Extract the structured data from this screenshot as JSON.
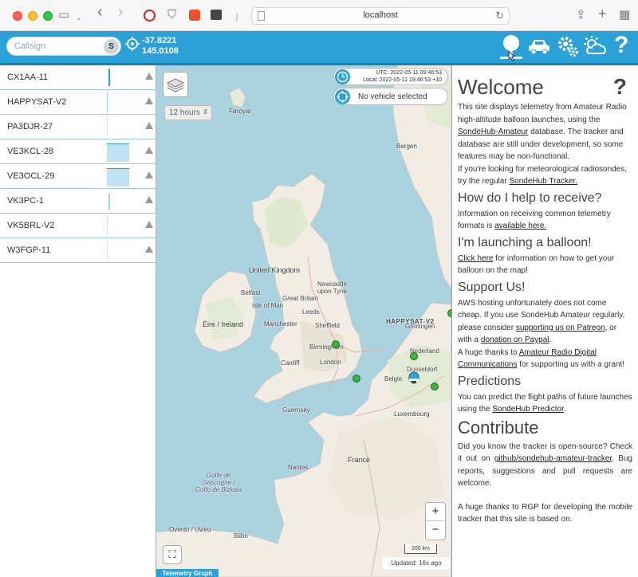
{
  "browser": {
    "url": "localhost"
  },
  "search": {
    "placeholder": "Callsign",
    "button": "S"
  },
  "coords": {
    "lat": "-37.8221",
    "lon": "145.0108"
  },
  "toolbar_icons": [
    "location-pin-icon",
    "car-icon",
    "settings-gears-icon",
    "weather-icon",
    "help-icon"
  ],
  "accent_color": "#2aa2d8",
  "payloads": [
    {
      "callsign": "CX1AA-11"
    },
    {
      "callsign": "HAPPYSAT-V2"
    },
    {
      "callsign": "PA3DJR-27"
    },
    {
      "callsign": "VE3KCL-28"
    },
    {
      "callsign": "VE3OCL-29"
    },
    {
      "callsign": "VK3PC-1"
    },
    {
      "callsign": "VK5BRL-V2"
    },
    {
      "callsign": "W3FGP-11"
    }
  ],
  "map": {
    "time_range": "12 hours",
    "clock": {
      "utc": "UTC: 2022-05-11 09:46:53",
      "local": "Local: 2022-05-11 19:46:53 +10"
    },
    "vehicle_status": "No vehicle selected",
    "scale": "200 km",
    "updated": "Updated: 16s ago",
    "telemetry_graph": "Telemetry Graph",
    "zoom_in": "+",
    "zoom_out": "−",
    "labels": {
      "faroyar": "Føroyar",
      "bergen": "Bergen",
      "uk": "United Kingdom",
      "gb": "Great Britain",
      "newcastle": "Newcastle upon Tyne",
      "belfast": "Belfast",
      "iom": "Isle of Man",
      "leeds": "Leeds",
      "manchester": "Manchester",
      "sheffield": "Sheffield",
      "eire": "Éire / Ireland",
      "birmingham": "Birmingham",
      "cardiff": "Cardiff",
      "london": "London",
      "happysat": "HAPPYSAT-V2",
      "groningen": "Groningen",
      "nederland": "Nederland",
      "dusseldorf": "Dusseldorf",
      "belgie": "Belgie",
      "guernsey": "Guernsey",
      "luxembourg": "Luxembourg",
      "france": "France",
      "nantes": "Nantes",
      "biscay": "Golfe de Gascogne / Golfo de Bizkaia",
      "oviedo": "Oviedo / Uviéu",
      "bilbo": "Bilbo"
    }
  },
  "panel": {
    "title": "Welcome",
    "help": "?",
    "intro_1": "This site displays telemetry from Amateur Radio high-altitude balloon launches, using the ",
    "intro_link": "SondeHub-Amateur",
    "intro_2": " database. The tracker and database are still under development, so some features may be non-functional.",
    "intro_3": "If you're looking for meteorological radiosondes, try the regular ",
    "intro_link2": "SondeHub Tracker.",
    "h_receive": "How do I help to receive?",
    "receive_1": "Information on receiving common telemetry formats is ",
    "receive_link": "available here.",
    "h_launch": "I'm launching a balloon!",
    "launch_link": "Click here",
    "launch_2": " for information on how to get your balloon on the map!",
    "h_support": "Support Us!",
    "support_1": "AWS hosting unfortunately does not come cheap. If you use SondeHub Amateur regularly, please consider ",
    "support_link1": "supporting us on Patreon",
    "support_2": ", or with a ",
    "support_link2": "donation on Paypal",
    "support_3": ".",
    "support_4": "A huge thanks to ",
    "support_link3": "Amateur Radio Digital Communications",
    "support_5": " for supporting us with a grant!",
    "h_predictions": "Predictions",
    "pred_1": "You can predict the flight paths of future launches using the ",
    "pred_link": "SondeHub Predictor",
    "pred_2": ".",
    "h_contribute": "Contribute",
    "contrib_1": "Did you know the tracker is open-source? Check it out on ",
    "contrib_link": "github/sondehub-amateur-tracker",
    "contrib_2": ". Bug reports, suggestions and pull requests are welcome.",
    "contrib_3": "A huge thanks to RGP for developing the mobile tracker that this site is based on."
  }
}
